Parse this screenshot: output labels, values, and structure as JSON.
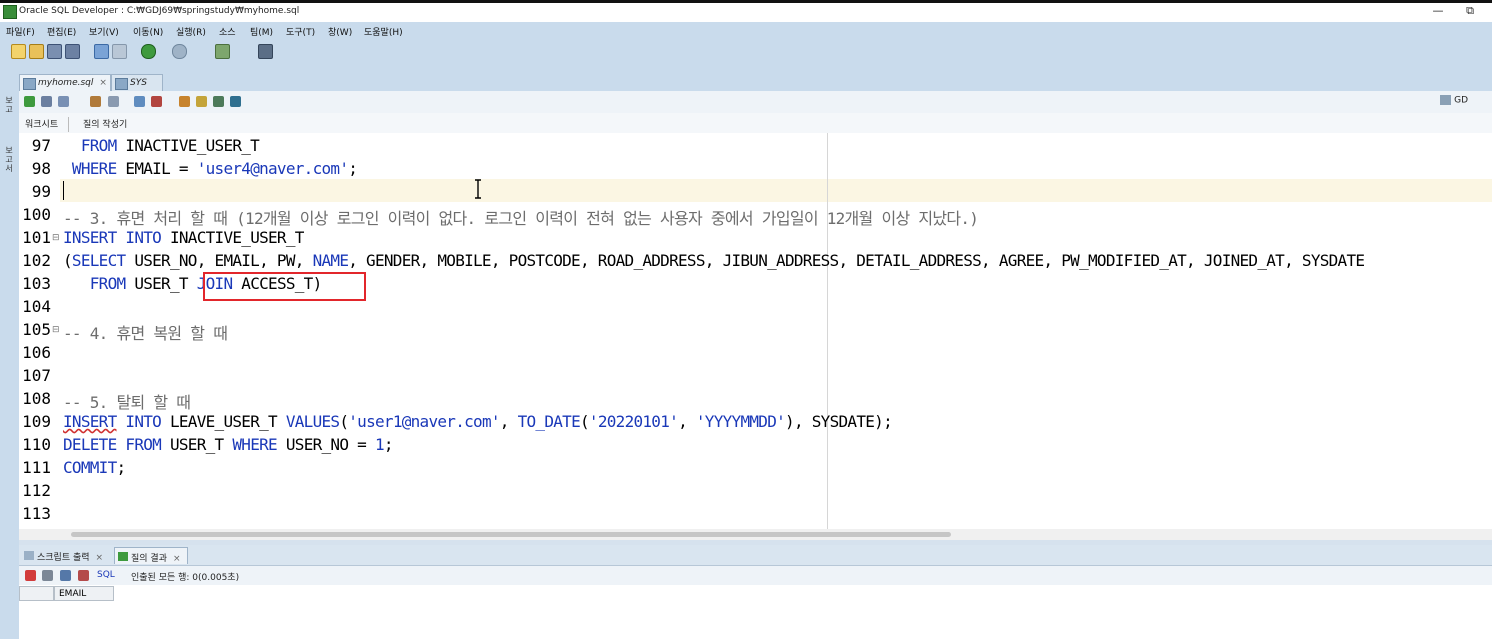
{
  "window": {
    "title": "Oracle SQL Developer : C:₩GDJ69₩springstudy₩myhome.sql",
    "minimize": "—",
    "restore": "⧉"
  },
  "menu": {
    "items": [
      "파일(F)",
      "편집(E)",
      "보기(V)",
      "이동(N)",
      "실행(R)",
      "소스",
      "팀(M)",
      "도구(T)",
      "창(W)",
      "도움말(H)"
    ]
  },
  "doc_tabs": [
    {
      "label": "myhome.sql",
      "close": "×"
    },
    {
      "label": "SYS"
    }
  ],
  "left_strip": {
    "labels": [
      "보고",
      "보고서"
    ]
  },
  "editor_toolbar": {
    "connection": "GD"
  },
  "sub_tabs": {
    "worksheet": "워크시트",
    "query_builder": "질의 작성기"
  },
  "editor": {
    "line_numbers": [
      "97",
      "98",
      "99",
      "100",
      "101",
      "102",
      "103",
      "104",
      "105",
      "106",
      "107",
      "108",
      "109",
      "110",
      "111",
      "112",
      "113"
    ],
    "code": {
      "l97": {
        "kw1": "FROM",
        "t1": " INACTIVE_USER_T"
      },
      "l98": {
        "kw1": "WHERE",
        "t1": " EMAIL = ",
        "s1": "'user4@naver.com'",
        "t2": ";"
      },
      "l100": {
        "cm": "-- 3. 휴면 처리 할 때 (12개월 이상 로그인 이력이 없다. 로그인 이력이 전혀 없는 사용자 중에서 가입일이 12개월 이상 지났다.)"
      },
      "l101": {
        "kw1": "INSERT",
        "t0": " ",
        "kw2": "INTO",
        "t1": " INACTIVE_USER_T"
      },
      "l102": {
        "t0": "(",
        "kw1": "SELECT",
        "t1": " USER_NO, EMAIL, PW, ",
        "kw2": "NAME",
        "t2": ", GENDER, MOBILE, POSTCODE, ROAD_ADDRESS, JIBUN_ADDRESS, DETAIL_ADDRESS, AGREE, PW_MODIFIED_AT, JOINED_AT, SYSDATE"
      },
      "l103": {
        "kw1": "FROM",
        "t1": " USER_T ",
        "kw2": "JOIN",
        "t2": " ACCESS_T)"
      },
      "l105": {
        "cm": "-- 4. 휴면 복원 할 때"
      },
      "l108": {
        "cm": "-- 5. 탈퇴 할 때"
      },
      "l109": {
        "kw1": "INSERT",
        "t0": " ",
        "kw2": "INTO",
        "t1": " LEAVE_USER_T ",
        "kw3": "VALUES",
        "t2": "(",
        "s1": "'user1@naver.com'",
        "t3": ", ",
        "kw4": "TO_DATE",
        "t4": "(",
        "s2": "'20220101'",
        "t5": ", ",
        "s3": "'YYYYMMDD'",
        "t6": "), SYSDATE);"
      },
      "l110": {
        "kw1": "DELETE",
        "t0": " ",
        "kw2": "FROM",
        "t1": " USER_T ",
        "kw3": "WHERE",
        "t2": " USER_NO = ",
        "s1": "1",
        "t3": ";"
      },
      "l111": {
        "kw1": "COMMIT",
        "t1": ";"
      }
    }
  },
  "bottom_panel": {
    "tabs": [
      {
        "label": "스크립트 출력",
        "close": "×"
      },
      {
        "label": "질의 결과",
        "close": "×"
      }
    ],
    "sql_label": "SQL",
    "status": "인출된 모든 행: 0(0.005초)",
    "columns": [
      "EMAIL"
    ]
  },
  "colors": {
    "keyword": "#1a38b8",
    "comment": "#6d6d6d",
    "highlight_box": "#e2262b",
    "chrome_bg": "#c9dbec"
  }
}
